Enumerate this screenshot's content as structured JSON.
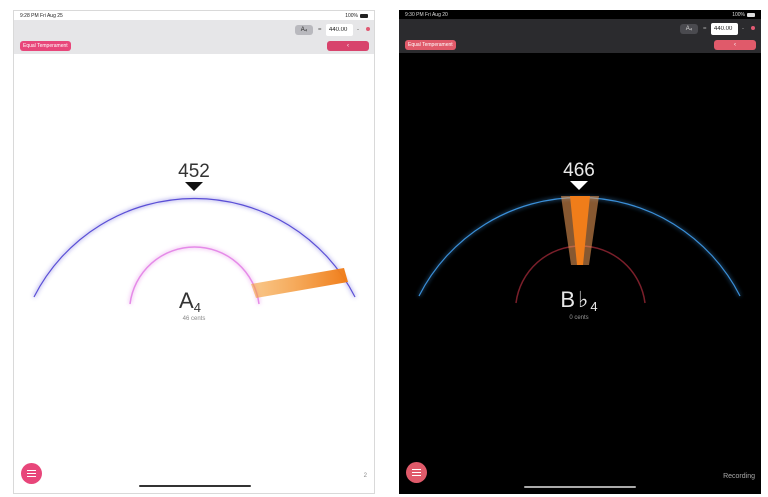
{
  "light": {
    "status": {
      "time": "9:28 PM  Fri Aug 25",
      "battery": "100%"
    },
    "toolbar": {
      "note": "A₄",
      "equals": "=",
      "frequency": "440.00",
      "minus": "-",
      "temperament": "Equal Temperament",
      "back": "‹"
    },
    "tuner": {
      "frequency": "452",
      "note_letter": "A",
      "note_octave": "4",
      "cents": "46 cents"
    },
    "page": "2",
    "colors": {
      "accent": "#e8467a",
      "arc": "#5a4fd6",
      "inner_arc": "#e58be8",
      "needle": "#f08a2a"
    }
  },
  "dark": {
    "status": {
      "time": "9:30 PM  Fri Aug 20",
      "battery": "100%"
    },
    "toolbar": {
      "note": "A₄",
      "equals": "=",
      "frequency": "440.00",
      "minus": "-",
      "temperament": "Equal Temperament",
      "back": "‹"
    },
    "tuner": {
      "frequency": "466",
      "note_letter": "B",
      "note_accidental": "♭",
      "note_octave": "4",
      "cents": "0 cents"
    },
    "recording": "Recording",
    "colors": {
      "accent": "#e05a6a",
      "arc": "#3a8fd8",
      "inner_arc": "#7a1f2a",
      "needle": "#f08a2a"
    }
  }
}
